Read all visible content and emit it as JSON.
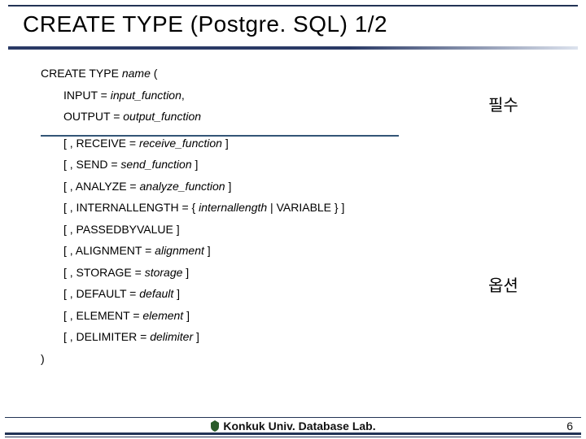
{
  "title": "CREATE TYPE (Postgre. SQL) 1/2",
  "statement_open": "CREATE TYPE",
  "name_placeholder": "name",
  "open_paren": "(",
  "required_label": "필수",
  "options_label": "옵션",
  "required": [
    {
      "prefix": "INPUT = ",
      "param": "input_function",
      "suffix": ","
    },
    {
      "prefix": "OUTPUT = ",
      "param": "output_function",
      "suffix": ""
    }
  ],
  "options": [
    {
      "prefix": "[ , RECEIVE = ",
      "param": "receive_function",
      "suffix": " ]"
    },
    {
      "prefix": "[ , SEND = ",
      "param": "send_function",
      "suffix": " ]"
    },
    {
      "prefix": "[ , ANALYZE = ",
      "param": "analyze_function",
      "suffix": " ]"
    },
    {
      "prefix": "[ , INTERNALLENGTH = { ",
      "param": "internallength",
      "suffix": " | VARIABLE } ]"
    },
    {
      "prefix": "[ , PASSEDBYVALUE ]",
      "param": "",
      "suffix": ""
    },
    {
      "prefix": "[ , ALIGNMENT = ",
      "param": "alignment",
      "suffix": " ]"
    },
    {
      "prefix": "[ , STORAGE = ",
      "param": "storage",
      "suffix": " ]"
    },
    {
      "prefix": "[ , DEFAULT = ",
      "param": "default",
      "suffix": " ]"
    },
    {
      "prefix": "[ , ELEMENT = ",
      "param": "element",
      "suffix": " ]"
    },
    {
      "prefix": "[ , DELIMITER = ",
      "param": "delimiter",
      "suffix": " ]"
    }
  ],
  "close_paren": ")",
  "footer_text": "Konkuk Univ. Database Lab.",
  "page_number": "6"
}
